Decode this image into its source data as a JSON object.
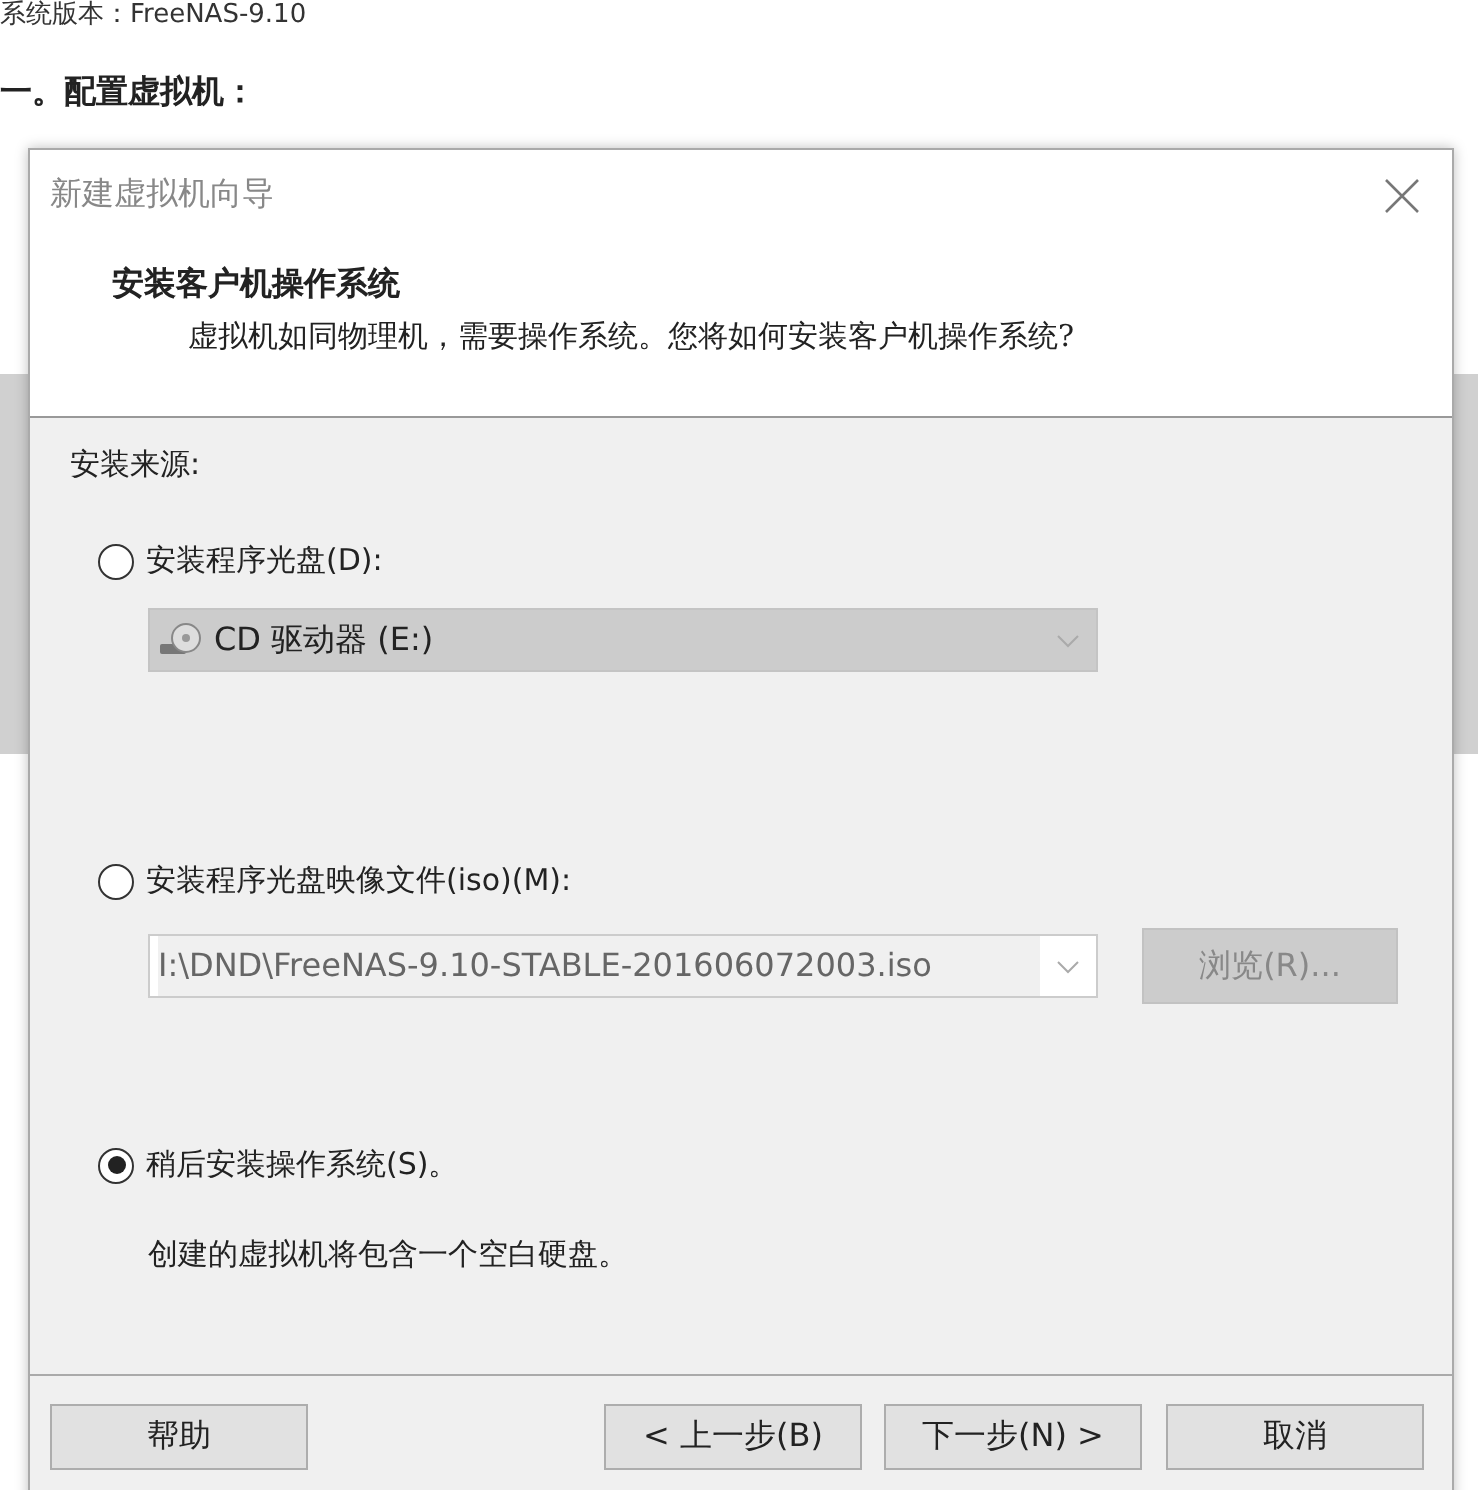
{
  "article": {
    "version_line": "系统版本：FreeNAS-9.10",
    "heading": "一。配置虚拟机："
  },
  "dialog": {
    "title": "新建虚拟机向导",
    "header_title": "安装客户机操作系统",
    "header_subtitle": "虚拟机如同物理机，需要操作系统。您将如何安装客户机操作系统?",
    "section_label": "安装来源:",
    "options": [
      {
        "kind": "drive",
        "label": "安装程序光盘(D):",
        "selected": false,
        "value": "CD 驱动器 (E:)",
        "disabled": true
      },
      {
        "kind": "file",
        "label": "安装程序光盘映像文件(iso)(M):",
        "selected": false,
        "value": "I:\\DND\\FreeNAS-9.10-STABLE-201606072003.iso",
        "browse": "浏览(R)...",
        "disabled": true
      },
      {
        "kind": "note",
        "label": "稍后安装操作系统(S)。",
        "selected": true,
        "note": "创建的虚拟机将包含一个空白硬盘。"
      }
    ],
    "buttons": [
      "帮助",
      "< 上一步(B)",
      "下一步(N) >",
      "取消"
    ]
  }
}
